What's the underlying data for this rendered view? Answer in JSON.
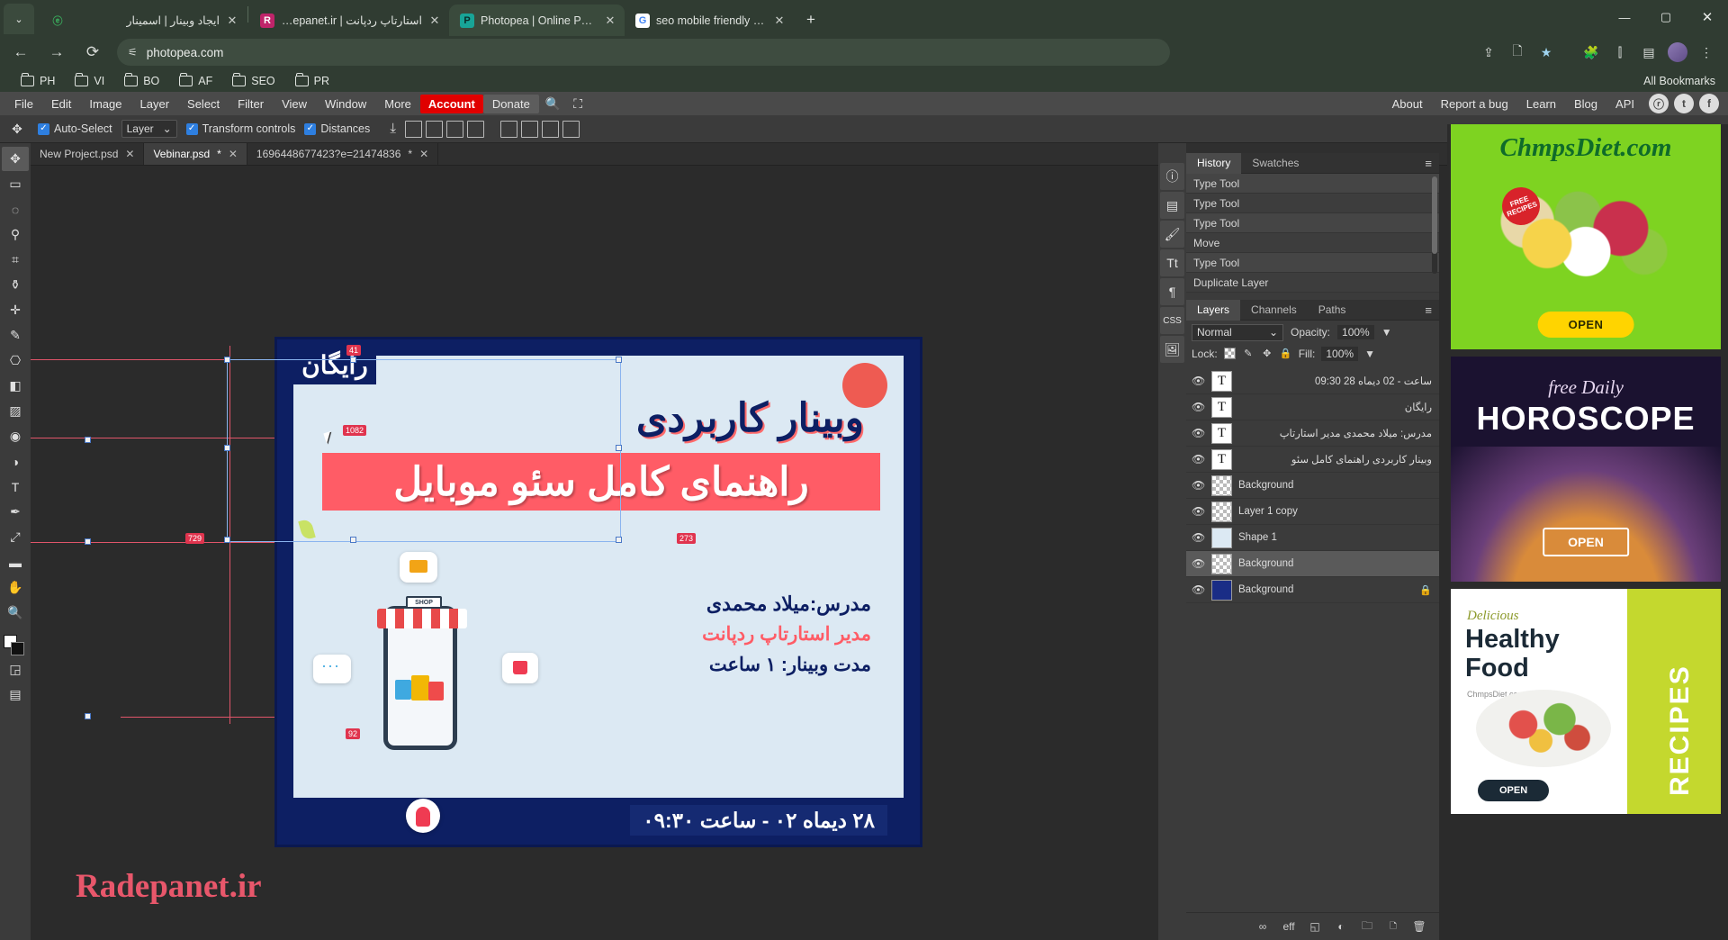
{
  "browser": {
    "tabs": [
      {
        "title": "ایجاد وبینار | اسمینار",
        "favicon": "e-icon",
        "state": "inactive",
        "rtl": true
      },
      {
        "title": "استارتاپ ردپانت | Radepanet.ir",
        "favicon": "radepanet-icon",
        "state": "inactive",
        "rtl": true
      },
      {
        "title": "Photopea | Online Photo Editor",
        "favicon": "photopea-icon",
        "state": "active",
        "rtl": false
      },
      {
        "title": "seo mobile friendly - Google S",
        "favicon": "google-icon",
        "state": "inactive",
        "rtl": false
      }
    ],
    "new_tab_label": "+",
    "tab_close_label": "✕",
    "tab_list_label": "⌄",
    "window_controls": {
      "minimize": "—",
      "maximize": "▢",
      "close": "✕"
    },
    "nav": {
      "back": "←",
      "forward": "→",
      "reload": "⟳"
    },
    "url": "photopea.com",
    "url_site_icon": "site-settings-icon",
    "omni_icons": {
      "share": "⇪",
      "doc": "🗋",
      "star": "★",
      "extensions": "🧩",
      "split": "⫿",
      "sidebar": "▤",
      "profile": "avatar",
      "menu": "⋮"
    },
    "bookmarks": [
      {
        "label": "PH"
      },
      {
        "label": "VI"
      },
      {
        "label": "BO"
      },
      {
        "label": "AF"
      },
      {
        "label": "SEO"
      },
      {
        "label": "PR"
      }
    ],
    "all_bookmarks_label": "All Bookmarks"
  },
  "photopea": {
    "menu": [
      "File",
      "Edit",
      "Image",
      "Layer",
      "Select",
      "Filter",
      "View",
      "Window",
      "More"
    ],
    "account_label": "Account",
    "donate_label": "Donate",
    "search_icon": "🔍",
    "fullscreen_icon": "⛶",
    "right_menu": [
      "About",
      "Report a bug",
      "Learn",
      "Blog",
      "API"
    ],
    "social": [
      {
        "name": "reddit-icon",
        "glyph": "ⓡ"
      },
      {
        "name": "twitter-icon",
        "glyph": "t"
      },
      {
        "name": "facebook-icon",
        "glyph": "f"
      }
    ],
    "options_bar": {
      "tool_icon": "move-tool-icon",
      "auto_select_label": "Auto-Select",
      "auto_select_checked": "✓",
      "layer_select_value": "Layer",
      "layer_select_caret": "⌄",
      "transform_controls_label": "Transform controls",
      "transform_controls_checked": "✓",
      "distances_label": "Distances",
      "distances_checked": "✓"
    },
    "doc_tabs": [
      {
        "name": "New Project.psd",
        "modified": "",
        "active": false
      },
      {
        "name": "Vebinar.psd",
        "modified": "*",
        "active": true
      },
      {
        "name": "1696448677423?e=21474836",
        "modified": "*",
        "active": false
      }
    ],
    "doc_tab_close": "✕",
    "tools": [
      {
        "name": "move-tool",
        "glyph": "✥",
        "selected": true
      },
      {
        "name": "marquee-tool",
        "glyph": "▭",
        "selected": false
      },
      {
        "name": "lasso-tool",
        "glyph": "◌",
        "selected": false
      },
      {
        "name": "magic-wand-tool",
        "glyph": "⚲",
        "selected": false
      },
      {
        "name": "crop-tool",
        "glyph": "⌗",
        "selected": false
      },
      {
        "name": "eyedropper-tool",
        "glyph": "⚱",
        "selected": false
      },
      {
        "name": "healing-brush-tool",
        "glyph": "✛",
        "selected": false
      },
      {
        "name": "brush-tool",
        "glyph": "✎",
        "selected": false
      },
      {
        "name": "stamp-tool",
        "glyph": "⎔",
        "selected": false
      },
      {
        "name": "eraser-tool",
        "glyph": "◧",
        "selected": false
      },
      {
        "name": "gradient-tool",
        "glyph": "▨",
        "selected": false
      },
      {
        "name": "blur-tool",
        "glyph": "◉",
        "selected": false
      },
      {
        "name": "dodge-tool",
        "glyph": "◑",
        "selected": false
      },
      {
        "name": "type-tool",
        "glyph": "T",
        "selected": false
      },
      {
        "name": "pen-tool",
        "glyph": "✒",
        "selected": false
      },
      {
        "name": "path-select-tool",
        "glyph": "⤢",
        "selected": false
      },
      {
        "name": "shape-tool",
        "glyph": "▬",
        "selected": false
      },
      {
        "name": "hand-tool",
        "glyph": "✋",
        "selected": false
      },
      {
        "name": "zoom-tool",
        "glyph": "🔍",
        "selected": false
      }
    ],
    "tool_extras": [
      {
        "name": "quick-mask-toggle",
        "glyph": "◲"
      },
      {
        "name": "screen-mode-toggle",
        "glyph": "▤"
      }
    ],
    "history": {
      "tabs": [
        {
          "label": "History",
          "active": true
        },
        {
          "label": "Swatches",
          "active": false
        }
      ],
      "menu_icon": "≡",
      "items": [
        "Type Tool",
        "Type Tool",
        "Type Tool",
        "Move",
        "Type Tool",
        "Duplicate Layer"
      ]
    },
    "layers": {
      "tabs": [
        {
          "label": "Layers",
          "active": true
        },
        {
          "label": "Channels",
          "active": false
        },
        {
          "label": "Paths",
          "active": false
        }
      ],
      "menu_icon": "≡",
      "blend_mode": "Normal",
      "blend_caret": "⌄",
      "opacity_label": "Opacity:",
      "opacity_value": "100%",
      "opacity_caret": "▼",
      "lock_label": "Lock:",
      "lock_icons": [
        "transparency-lock-icon",
        "paint-lock-icon",
        "move-lock-icon",
        "all-lock-icon"
      ],
      "fill_label": "Fill:",
      "fill_value": "100%",
      "fill_caret": "▼",
      "rows": [
        {
          "name": "ساعت - 02 دیماه 28 09:30",
          "type": "text",
          "visible": true,
          "selected": false,
          "rtl": true,
          "locked": false
        },
        {
          "name": "رایگان",
          "type": "text",
          "visible": true,
          "selected": false,
          "rtl": true,
          "locked": false
        },
        {
          "name": "مدرس: میلاد محمدی مدیر استارتاپ",
          "type": "text",
          "visible": true,
          "selected": false,
          "rtl": true,
          "locked": false
        },
        {
          "name": "وبینار کاربردی راهنمای کامل سئو",
          "type": "text",
          "visible": true,
          "selected": false,
          "rtl": true,
          "locked": false
        },
        {
          "name": "Background",
          "type": "transparent",
          "visible": true,
          "selected": false,
          "rtl": false,
          "locked": false
        },
        {
          "name": "Layer 1 copy",
          "type": "transparent",
          "visible": true,
          "selected": false,
          "rtl": false,
          "locked": false
        },
        {
          "name": "Shape 1",
          "type": "shape",
          "visible": true,
          "selected": false,
          "rtl": false,
          "locked": false
        },
        {
          "name": "Background",
          "type": "transparent",
          "visible": true,
          "selected": true,
          "rtl": false,
          "locked": false
        },
        {
          "name": "Background",
          "type": "solid",
          "visible": true,
          "selected": false,
          "rtl": false,
          "locked": true
        }
      ],
      "eye_glyph": "👁",
      "type_glyph": "T",
      "lock_glyph": "🔒",
      "bottom_buttons": [
        {
          "name": "link-layers-button",
          "glyph": "∞"
        },
        {
          "name": "layer-effects-button",
          "glyph": "eff"
        },
        {
          "name": "layer-mask-button",
          "glyph": "◱"
        },
        {
          "name": "adjustment-layer-button",
          "glyph": "◐"
        },
        {
          "name": "new-group-button",
          "glyph": "🗀"
        },
        {
          "name": "new-layer-button",
          "glyph": "🗅"
        },
        {
          "name": "delete-layer-button",
          "glyph": "🗑"
        }
      ]
    },
    "side_buttons": [
      {
        "name": "info-panel-button",
        "glyph": "ⓘ"
      },
      {
        "name": "histogram-panel-button",
        "glyph": "▤"
      },
      {
        "name": "brushes-panel-button",
        "glyph": "🖌"
      },
      {
        "name": "character-panel-button",
        "glyph": "Tt"
      },
      {
        "name": "paragraph-panel-button",
        "glyph": "¶"
      },
      {
        "name": "css-panel-button",
        "glyph": "CSS"
      },
      {
        "name": "properties-panel-button",
        "glyph": "🖼"
      }
    ],
    "panel_collapse_icon": "⟨⟩"
  },
  "canvas": {
    "artwork": {
      "free_badge": "رایگان",
      "title_line1": "وبینار کاربردی",
      "title_line2": "راهنمای کامل سئو موبایل",
      "instructor_line": "مدرس:میلاد محمدی",
      "role_line": "مدیر استارتاپ ردپانت",
      "duration_line": "مدت وبینار: ۱ ساعت",
      "date_line": "۲۸ دیماه ۰۲ - ساعت ۰۹:۳۰",
      "shop_sign": "SHOP"
    },
    "dimension_tags": [
      {
        "value": "41",
        "name": "distance-tag-top"
      },
      {
        "value": "1082",
        "name": "distance-tag-left"
      },
      {
        "value": "729",
        "name": "distance-tag-left-outer"
      },
      {
        "value": "273",
        "name": "distance-tag-right"
      },
      {
        "value": "92",
        "name": "distance-tag-bottom"
      }
    ],
    "watermark": "Radepanet.ir"
  },
  "ads": [
    {
      "name": "chmpsdiet-ad",
      "title": "ChmpsDiet.com",
      "badge": "FREE RECIPES",
      "button": "OPEN"
    },
    {
      "name": "horoscope-ad",
      "title_small": "free Daily",
      "title_big": "HOROSCOPE",
      "button": "OPEN"
    },
    {
      "name": "healthyfood-ad",
      "kicker": "Delicious",
      "line1": "Healthy",
      "line2": "Food",
      "sub": "ChmpsDiet.com",
      "side": "RECIPES",
      "button": "OPEN"
    }
  ]
}
